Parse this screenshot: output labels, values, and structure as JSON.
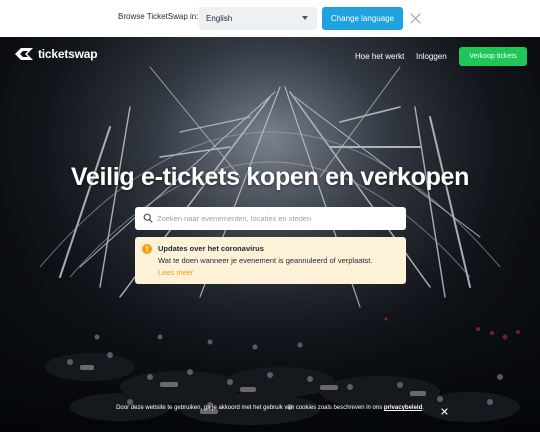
{
  "language_banner": {
    "prompt": "Browse TicketSwap in:",
    "selected_language": "English",
    "change_button": "Change language"
  },
  "header": {
    "brand": "ticketswap",
    "nav": {
      "how_it_works": "Hoe het werkt",
      "login": "Inloggen",
      "sell_tickets": "Verkoop tickets"
    }
  },
  "hero": {
    "headline": "Veilig e-tickets kopen en verkopen",
    "search_placeholder": "Zoeken naar evenementen, locaties en steden"
  },
  "notice": {
    "title": "Updates over het coronavirus",
    "body": "Wat te doen wanneer je evenement is geannuleerd of verplaatst.",
    "link": "Lees meer"
  },
  "cookie_bar": {
    "text": "Door deze website te gebruiken, ga je akkoord met het gebruik van cookies zoals beschreven in ons ",
    "link": "privacybeleid",
    "suffix": "."
  },
  "colors": {
    "accent_blue": "#1fa2df",
    "accent_green": "#1fc65a",
    "notice_bg": "#fdf1d8",
    "warning": "#f59e0b"
  },
  "icons": [
    "close-icon",
    "logo-icon",
    "search-icon",
    "info-icon",
    "chevron-down-icon"
  ]
}
